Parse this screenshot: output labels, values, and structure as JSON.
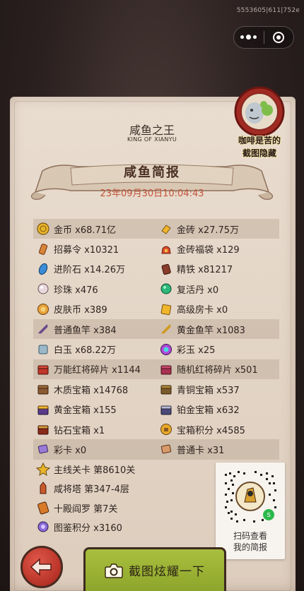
{
  "build_id": "5553605|611|752e",
  "header": {
    "title": "咸鱼之王",
    "subtitle": "KING OF XIANYU"
  },
  "banner": {
    "title": "咸鱼简报",
    "date": "23年09月30日10:04:43"
  },
  "badge": {
    "line1": "咖啡是苦的",
    "line2": "截图隐藏"
  },
  "resources": [
    [
      {
        "icon": "gold-coin-icon",
        "label": "金币 x68.71亿"
      },
      {
        "icon": "gold-brick-icon",
        "label": "金砖 x27.75万"
      }
    ],
    [
      {
        "icon": "recruit-order-icon",
        "label": "招募令 x10321"
      },
      {
        "icon": "gold-brick-bag-icon",
        "label": "金砖福袋 x129"
      }
    ],
    [
      {
        "icon": "advance-stone-icon",
        "label": "进阶石 x14.26万"
      },
      {
        "icon": "refined-iron-icon",
        "label": "精铁 x81217"
      }
    ],
    [
      {
        "icon": "pearl-icon",
        "label": "珍珠 x476"
      },
      {
        "icon": "revive-pill-icon",
        "label": "复活丹 x0"
      }
    ],
    [
      {
        "icon": "skin-coin-icon",
        "label": "皮肤币 x389"
      },
      {
        "icon": "premium-room-card-icon",
        "label": "高级房卡 x0"
      }
    ],
    [
      {
        "icon": "fishing-rod-icon",
        "label": "普通鱼竿 x384"
      },
      {
        "icon": "gold-fishing-rod-icon",
        "label": "黄金鱼竿 x1083"
      }
    ],
    [
      {
        "icon": "white-jade-icon",
        "label": "白玉 x68.22万"
      },
      {
        "icon": "color-jade-icon",
        "label": "彩玉 x25"
      }
    ],
    [
      {
        "icon": "universal-shard-chest-icon",
        "label": "万能红将碎片 x1144"
      },
      {
        "icon": "random-shard-chest-icon",
        "label": "随机红将碎片 x501"
      }
    ],
    [
      {
        "icon": "wooden-chest-icon",
        "label": "木质宝箱 x14768"
      },
      {
        "icon": "bronze-chest-icon",
        "label": "青铜宝箱 x537"
      }
    ],
    [
      {
        "icon": "gold-chest-icon",
        "label": "黄金宝箱 x155"
      },
      {
        "icon": "platinum-chest-icon",
        "label": "铂金宝箱 x632"
      }
    ],
    [
      {
        "icon": "diamond-chest-icon",
        "label": "钻石宝箱 x1"
      },
      {
        "icon": "chest-points-icon",
        "label": "宝箱积分 x4585"
      }
    ],
    [
      {
        "icon": "color-card-icon",
        "label": "彩卡 x0"
      },
      {
        "icon": "normal-card-icon",
        "label": "普通卡 x31"
      }
    ]
  ],
  "progress": [
    {
      "icon": "main-stage-icon",
      "label": "主线关卡 第8610关"
    },
    {
      "icon": "tower-icon",
      "label": "咸将塔 第347-4层"
    },
    {
      "icon": "yama-icon",
      "label": "十殿阎罗 第7关"
    },
    {
      "icon": "codex-points-icon",
      "label": "图鉴积分 x3160"
    }
  ],
  "qr": {
    "line1": "扫码查看",
    "line2": "我的简报"
  },
  "actions": {
    "share_label": "截图炫耀一下"
  },
  "colors": {
    "accent_red": "#c0543a",
    "share_green": "#9cb435",
    "paper": "#e6d9cb"
  }
}
